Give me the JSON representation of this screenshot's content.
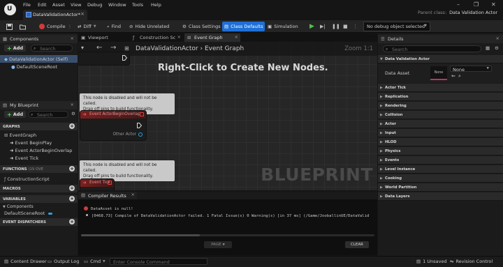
{
  "menu": {
    "items": [
      "File",
      "Edit",
      "Asset",
      "View",
      "Debug",
      "Window",
      "Tools",
      "Help"
    ]
  },
  "asset_tab": {
    "title": "DataValidationActor*"
  },
  "parent_class": {
    "label": "Parent class:",
    "value": "Data Validation Actor"
  },
  "toolbar": {
    "compile": "Compile",
    "diff": "Diff",
    "find": "Find",
    "hide_unrelated": "Hide Unrelated",
    "class_settings": "Class Settings",
    "class_defaults": "Class Defaults",
    "simulation": "Simulation",
    "debug_object": "No debug object selected"
  },
  "components": {
    "title": "Components",
    "add": "Add",
    "search_placeholder": "Search",
    "items": [
      "DataValidationActor (Self)",
      "DefaultSceneRoot"
    ]
  },
  "my_blueprint": {
    "title": "My Blueprint",
    "add": "Add",
    "search_placeholder": "Search",
    "graphs_label": "GRAPHS",
    "graph_items": [
      "EventGraph",
      "Event BeginPlay",
      "Event ActorBeginOverlap",
      "Event Tick"
    ],
    "functions_label": "FUNCTIONS",
    "functions_count": "(19 OVE",
    "function_items": [
      "ConstructionScript"
    ],
    "macros_label": "MACROS",
    "variables_label": "VARIABLES",
    "components_label": "Components",
    "variable_items": [
      "DefaultSceneRoot"
    ],
    "dispatchers_label": "EVENT DISPATCHERS"
  },
  "viewport_tabs": [
    "Viewport",
    "Construction Sc",
    "Event Graph"
  ],
  "graph": {
    "breadcrumb_asset": "DataValidationActor",
    "breadcrumb_sep": "›",
    "breadcrumb_graph": "Event Graph",
    "zoom": "Zoom 1:1",
    "hint": "Right-Click to Create New Nodes.",
    "watermark": "BLUEPRINT",
    "disabled_note_line1": "This node is disabled and will not be called.",
    "disabled_note_line2": "Drag off pins to build functionality.",
    "overlap_node_title": "Event ActorBeginOverlap",
    "overlap_pin_label": "Other Actor",
    "tick_node_title": "Event Tick"
  },
  "compiler": {
    "tab": "Compiler Results",
    "line1": "DataAsset is null!",
    "line2": "[0468.73] Compile of DataValidationActor failed. 1 Fatal Issue(s) 0 Warning(s) [in 37 ms] (/Game/JooballinUE/DataValid",
    "page": "PAGE",
    "clear": "CLEAR"
  },
  "details": {
    "title": "Details",
    "search_placeholder": "Search",
    "section_main": "Data Validation Actor",
    "data_asset_label": "Data Asset",
    "data_asset_thumb": "None",
    "data_asset_value": "None",
    "sections": [
      "Actor Tick",
      "Replication",
      "Rendering",
      "Collision",
      "Actor",
      "Input",
      "HLOD",
      "Physics",
      "Events",
      "Level Instance",
      "Cooking",
      "World Partition",
      "Data Layers"
    ]
  },
  "status": {
    "content_drawer": "Content Drawer",
    "output_log": "Output Log",
    "cmd": "Cmd",
    "console_placeholder": "Enter Console Command",
    "unsaved": "1 Unsaved",
    "revision": "Revision Control"
  },
  "colors": {
    "accent": "#1f6fd6",
    "error": "#d23a3a",
    "node_header": "#7d1f1f",
    "play": "#4fc24f"
  }
}
